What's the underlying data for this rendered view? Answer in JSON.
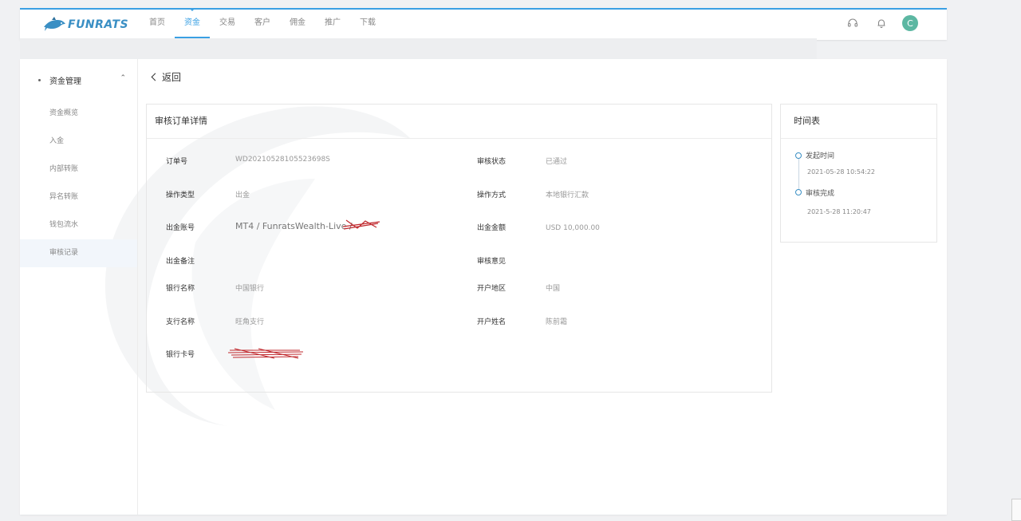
{
  "brand": {
    "name": "FUNRATS"
  },
  "nav": {
    "items": [
      {
        "label": "首页",
        "active": false
      },
      {
        "label": "资金",
        "active": true
      },
      {
        "label": "交易",
        "active": false
      },
      {
        "label": "客户",
        "active": false
      },
      {
        "label": "佣金",
        "active": false
      },
      {
        "label": "推广",
        "active": false
      },
      {
        "label": "下载",
        "active": false
      }
    ]
  },
  "user": {
    "avatar_initial": "C",
    "avatar_color": "#5cb7a2"
  },
  "sidebar": {
    "section": "资金管理",
    "items": [
      {
        "label": "资金概览",
        "active": false
      },
      {
        "label": "入金",
        "active": false
      },
      {
        "label": "内部转账",
        "active": false
      },
      {
        "label": "异名转账",
        "active": false
      },
      {
        "label": "钱包流水",
        "active": false
      },
      {
        "label": "审核记录",
        "active": true
      }
    ]
  },
  "back_label": "返回",
  "detail": {
    "title": "审核订单详情",
    "rows": [
      {
        "l1": "订单号",
        "v1": "WD20210528105523698S",
        "l2": "审核状态",
        "v2": "已通过"
      },
      {
        "l1": "操作类型",
        "v1": "出金",
        "l2": "操作方式",
        "v2": "本地银行汇款"
      },
      {
        "l1": "出金账号",
        "v1": "MT4 / FunratsWealth-Live /",
        "l2": "出金金额",
        "v2": "USD 10,000.00"
      },
      {
        "l1": "出金备注",
        "v1": "",
        "l2": "审核意见",
        "v2": ""
      },
      {
        "l1": "银行名称",
        "v1": "中国银行",
        "l2": "开户地区",
        "v2": "中国"
      },
      {
        "l1": "支行名称",
        "v1": "旺角支行",
        "l2": "开户姓名",
        "v2": "陈前霜"
      },
      {
        "l1": "银行卡号",
        "v1": "",
        "l2": "",
        "v2": ""
      }
    ]
  },
  "timeline": {
    "title": "时间表",
    "events": [
      {
        "label": "发起时间",
        "time": "2021-05-28 10:54:22"
      },
      {
        "label": "审核完成",
        "time": "2021-5-28 11:20:47"
      }
    ]
  },
  "colors": {
    "accent": "#3aa0e3",
    "redaction": "#c0282d"
  }
}
